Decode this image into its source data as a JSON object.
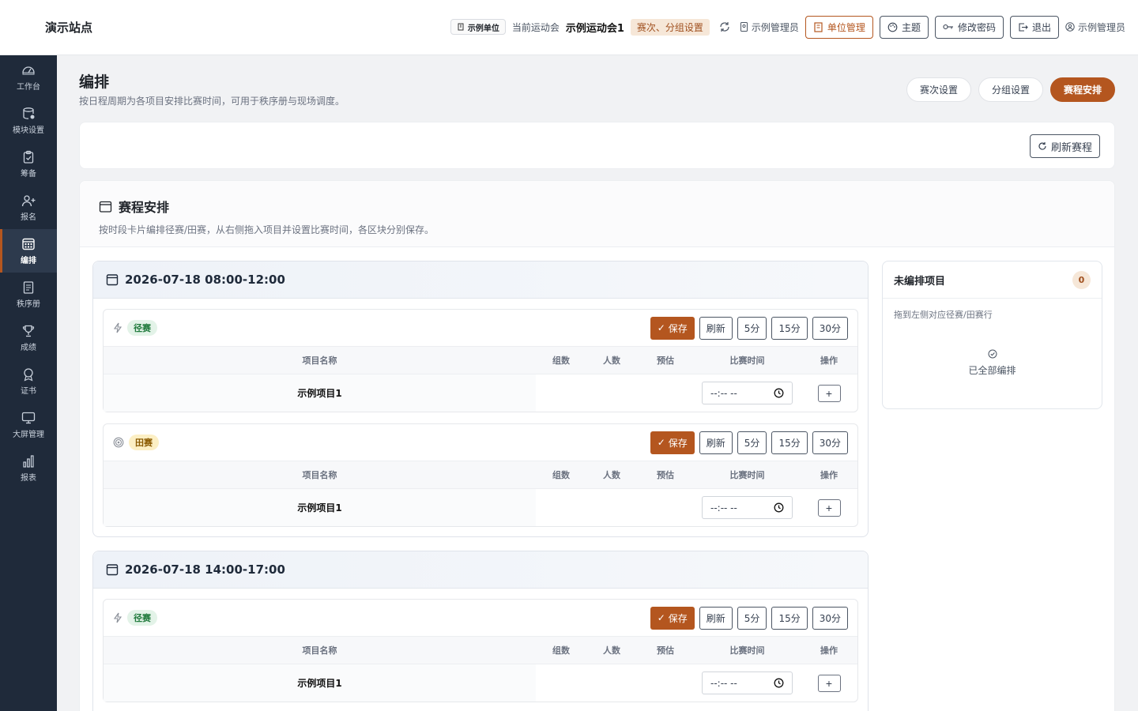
{
  "site": {
    "brand": "演示站点"
  },
  "header": {
    "unit": "示例单位",
    "current_label": "当前运动会",
    "meet_name": "示例运动会1",
    "meet_tag": "赛次、分组设置",
    "admin_label": "示例管理员",
    "buttons": {
      "unit_mgmt": "单位管理",
      "theme": "主题",
      "change_pwd": "修改密码",
      "logout": "退出"
    },
    "user": "示例管理员"
  },
  "sidebar": {
    "items": [
      {
        "label": "工作台",
        "icon": "dashboard-icon"
      },
      {
        "label": "模块设置",
        "icon": "database-icon"
      },
      {
        "label": "筹备",
        "icon": "clipboard-icon"
      },
      {
        "label": "报名",
        "icon": "user-plus-icon"
      },
      {
        "label": "编排",
        "icon": "calendar-grid-icon",
        "active": true
      },
      {
        "label": "秩序册",
        "icon": "book-icon"
      },
      {
        "label": "成绩",
        "icon": "trophy-icon"
      },
      {
        "label": "证书",
        "icon": "award-icon"
      },
      {
        "label": "大屏管理",
        "icon": "monitor-icon"
      },
      {
        "label": "报表",
        "icon": "bar-chart-icon"
      }
    ]
  },
  "page": {
    "title": "编排",
    "subtitle": "按日程周期为各项目安排比赛时间，可用于秩序册与现场调度。",
    "tabs": [
      "赛次设置",
      "分组设置",
      "赛程安排"
    ],
    "active_tab": "赛程安排",
    "refresh_label": "刷新赛程"
  },
  "schedule": {
    "title": "赛程安排",
    "subtitle": "按时段卡片编排径赛/田赛，从右侧拖入项目并设置比赛时间，各区块分别保存。",
    "columns": [
      "项目名称",
      "组数",
      "人数",
      "预估",
      "比赛时间",
      "操作"
    ],
    "buttons": {
      "save": "保存",
      "refresh": "刷新",
      "m5": "5分",
      "m15": "15分",
      "m30": "30分"
    },
    "time_placeholder": "--:-- --",
    "periods": [
      {
        "label": "2026-07-18 08:00-12:00",
        "blocks": [
          {
            "type": "径赛",
            "row": {
              "name": "示例项目1",
              "groups": "",
              "people": "",
              "estimate": ""
            }
          },
          {
            "type": "田赛",
            "row": {
              "name": "示例项目1",
              "groups": "",
              "people": "",
              "estimate": ""
            }
          }
        ]
      },
      {
        "label": "2026-07-18 14:00-17:00",
        "blocks": [
          {
            "type": "径赛",
            "row": {
              "name": "示例项目1",
              "groups": "",
              "people": "",
              "estimate": ""
            }
          }
        ]
      }
    ]
  },
  "unscheduled": {
    "title": "未编排项目",
    "count": "0",
    "hint": "拖到左侧对应径赛/田赛行",
    "done": "已全部编排"
  },
  "colors": {
    "accent": "#b4561f",
    "sidebar": "#1f2a3a"
  }
}
